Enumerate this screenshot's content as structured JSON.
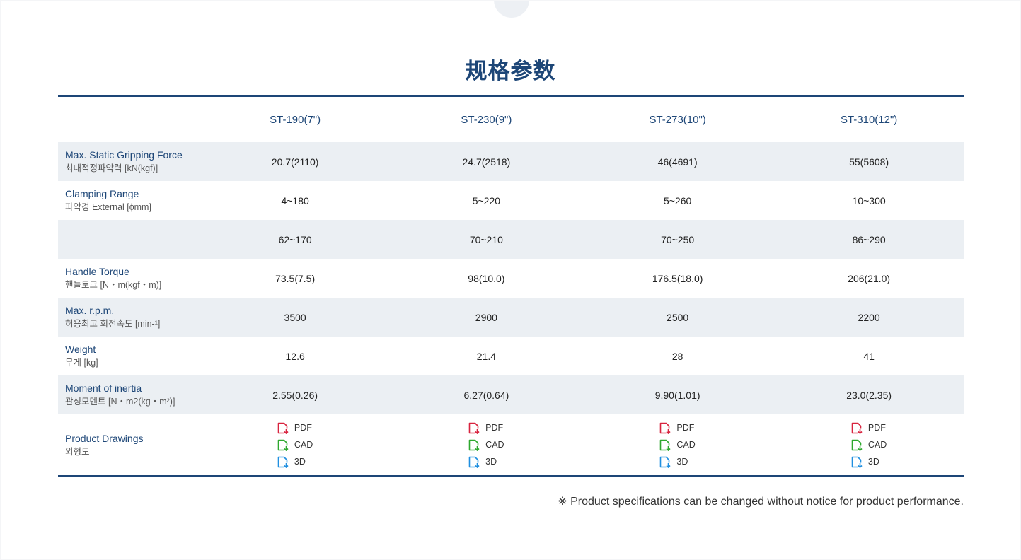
{
  "title": "规格参数",
  "columns": [
    "ST-190(7\")",
    "ST-230(9\")",
    "ST-273(10\")",
    "ST-310(12\")"
  ],
  "rows": [
    {
      "en": "Max. Static Gripping Force",
      "ko": "최대적정파악력 [kN(kgf)]",
      "values": [
        "20.7(2110)",
        "24.7(2518)",
        "46(4691)",
        "55(5608)"
      ]
    },
    {
      "en": "Clamping Range",
      "ko": "파악경 External [ɸmm]",
      "values": [
        "4~180",
        "5~220",
        "5~260",
        "10~300"
      ]
    },
    {
      "en": "",
      "ko": "",
      "values": [
        "62~170",
        "70~210",
        "70~250",
        "86~290"
      ]
    },
    {
      "en": "Handle Torque",
      "ko": "핸들토크 [N・m(kgf・m)]",
      "values": [
        "73.5(7.5)",
        "98(10.0)",
        "176.5(18.0)",
        "206(21.0)"
      ]
    },
    {
      "en": "Max. r.p.m.",
      "ko": "허용최고 회전속도 [min-¹]",
      "values": [
        "3500",
        "2900",
        "2500",
        "2200"
      ]
    },
    {
      "en": "Weight",
      "ko": "무게 [kg]",
      "values": [
        "12.6",
        "21.4",
        "28",
        "41"
      ]
    },
    {
      "en": "Moment of inertia",
      "ko": "관성모멘트 [N・m2(kg・m²)]",
      "values": [
        "2.55(0.26)",
        "6.27(0.64)",
        "9.90(1.01)",
        "23.0(2.35)"
      ]
    }
  ],
  "drawings": {
    "en": "Product Drawings",
    "ko": "외형도",
    "files": [
      {
        "label": "PDF",
        "icon": "pdf-file-icon",
        "color": "#d8243f"
      },
      {
        "label": "CAD",
        "icon": "cad-file-icon",
        "color": "#2ea82e"
      },
      {
        "label": "3D",
        "icon": "3d-file-icon",
        "color": "#1f8fe0"
      }
    ]
  },
  "notice": "※ Product specifications can be changed without notice for product performance.",
  "colors": {
    "accent": "#1d4677",
    "row_shade": "#ebeff3"
  }
}
